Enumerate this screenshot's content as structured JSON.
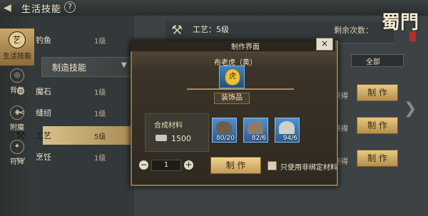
{
  "header": {
    "title": "生活技能",
    "help": "?"
  },
  "left_nav": [
    {
      "label": "生活技能",
      "icon": "craft-icon",
      "active": true
    },
    {
      "label": "背包",
      "icon": "bag-icon"
    },
    {
      "label": "附魔",
      "icon": "enchant-icon"
    },
    {
      "label": "符阵",
      "icon": "rune-icon"
    }
  ],
  "skills": {
    "top_items": [
      {
        "name": "钓鱼",
        "level": "1级"
      }
    ],
    "category": "制造技能",
    "items": [
      {
        "name": "魔石",
        "level": "1级"
      },
      {
        "name": "缝纫",
        "level": "1级"
      },
      {
        "name": "工艺",
        "level": "5级"
      },
      {
        "name": "烹饪",
        "level": "1级"
      }
    ]
  },
  "main": {
    "craft_title": "工艺：5级",
    "remaining": "剩余次数：",
    "filter": "全部",
    "side_get": "获得",
    "side_button": "制 作"
  },
  "logo": {
    "text": "蜀門"
  },
  "modal": {
    "title": "制作界面",
    "close": "×",
    "item_name": "布老虎（黄）",
    "item_type": "装饰品",
    "materials_label": "合成材料",
    "cost": "1500",
    "materials": [
      {
        "name": "material-rock",
        "count": "80/20"
      },
      {
        "name": "material-ore",
        "count": "82/6"
      },
      {
        "name": "material-silver",
        "count": "94/6"
      }
    ],
    "quantity": "1",
    "minus": "−",
    "plus": "+",
    "craft_button": "制 作",
    "bound_only_label": "只使用非绑定材料"
  }
}
